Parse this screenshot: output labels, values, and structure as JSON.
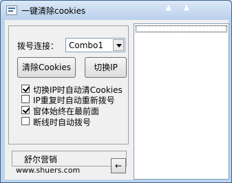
{
  "window": {
    "title": "一键清除cookies"
  },
  "titlebar": {
    "left_glyph": "▲",
    "right_glyph": "▲"
  },
  "dial": {
    "label": "拨号连接：",
    "selected": "Combo1"
  },
  "buttons": {
    "clear_cookies": "清除Cookies",
    "switch_ip": "切换IP"
  },
  "options": [
    {
      "label": "切换IP时自动清Cookies",
      "checked": true
    },
    {
      "label": "IP重复时自动重新拨号",
      "checked": false
    },
    {
      "label": "窗体始终在最前面",
      "checked": true
    },
    {
      "label": "断线时自动拨号",
      "checked": false
    }
  ],
  "status": {
    "text": ""
  },
  "footer": {
    "name": "舒尔营销",
    "url": "www.shuers.com",
    "arrow": "←"
  }
}
